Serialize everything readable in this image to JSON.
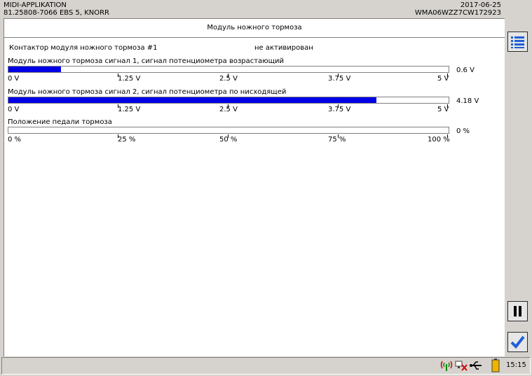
{
  "header": {
    "app_name": "MIDI-APPLIKATION",
    "ecu_info": "81.25808-7066  EBS 5, KNORR",
    "date": "2017-06-25",
    "vin": "WMA06WZZ7CW172923"
  },
  "panel": {
    "title": "Модуль ножного тормоза"
  },
  "contactor": {
    "label": "Контактор модуля ножного тормоза #1",
    "state": "не активирован"
  },
  "gauges": [
    {
      "label": "Модуль ножного тормоза сигнал 1, сигнал потенциометра возрастающий",
      "value_text": "0.6 V",
      "fill_fraction": 0.12,
      "ticks": [
        "0 V",
        "1.25 V",
        "2.5 V",
        "3.75 V",
        "5 V"
      ]
    },
    {
      "label": "Модуль ножного тормоза сигнал 2, сигнал потенциометра по нисходящей",
      "value_text": "4.18 V",
      "fill_fraction": 0.836,
      "ticks": [
        "0 V",
        "1.25 V",
        "2.5 V",
        "3.75 V",
        "5 V"
      ]
    },
    {
      "label": "Положение педали тормоза",
      "value_text": "0 %",
      "fill_fraction": 0,
      "ticks": [
        "0 %",
        "25 %",
        "50 %",
        "75 %",
        "100 %"
      ]
    }
  ],
  "sidebar": {
    "menu_icon": "list-menu-icon",
    "pause_icon": "pause-icon",
    "confirm_icon": "checkmark-icon"
  },
  "statusbar": {
    "icons": [
      "wireless-signal-icon",
      "network-disconnected-icon",
      "usb-icon",
      "battery-icon"
    ],
    "time": "15:15"
  },
  "colors": {
    "bar_fill": "#0000e6",
    "accent_blue": "#1f5fd6"
  }
}
